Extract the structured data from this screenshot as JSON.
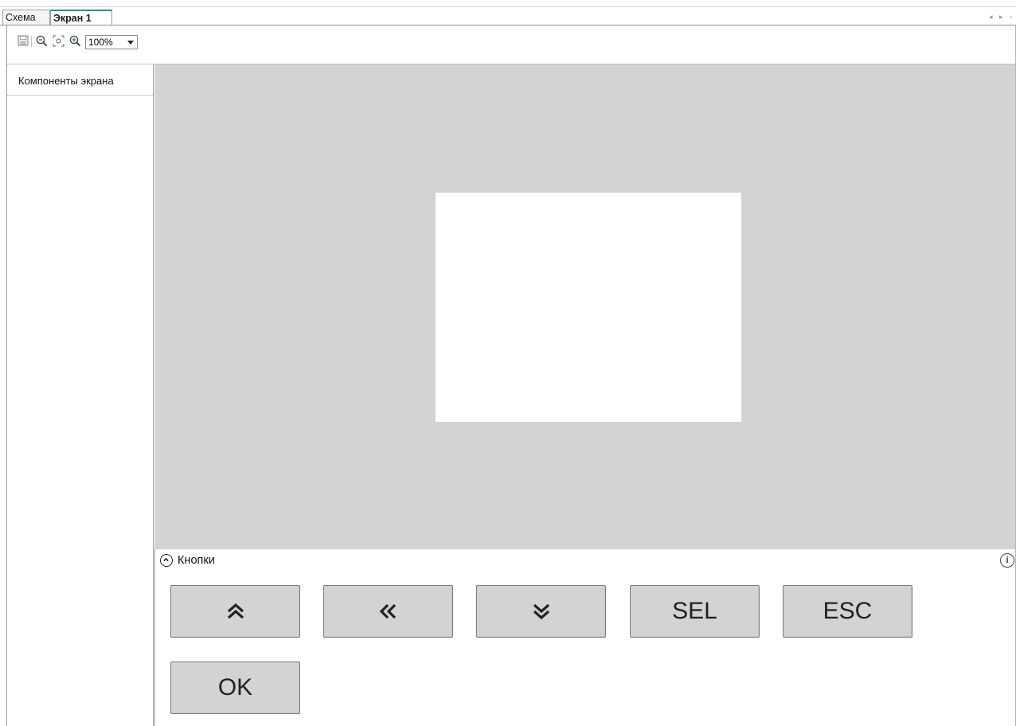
{
  "tabs": [
    {
      "label": "Схема",
      "active": false
    },
    {
      "label": "Экран 1",
      "active": true
    }
  ],
  "toolbar": {
    "icons": [
      "save-icon",
      "zoom-out-icon",
      "fit-icon",
      "zoom-in-icon"
    ],
    "zoom_value": "100%"
  },
  "sidepanel": {
    "header": "Компоненты экрана"
  },
  "canvas": {
    "background_color": "#d3d3d3",
    "screen_color": "#ffffff"
  },
  "buttons_panel": {
    "title": "Кнопки",
    "buttons": [
      {
        "label": "",
        "icon": "double-chevron-up-icon"
      },
      {
        "label": "",
        "icon": "double-chevron-left-icon"
      },
      {
        "label": "",
        "icon": "double-chevron-down-icon"
      },
      {
        "label": "SEL"
      },
      {
        "label": "ESC"
      },
      {
        "label": "OK"
      }
    ]
  },
  "colors": {
    "active_tab_accent": "#2a8d9a",
    "button_fill": "#d3d3d3",
    "button_border": "#7b7b7b"
  }
}
